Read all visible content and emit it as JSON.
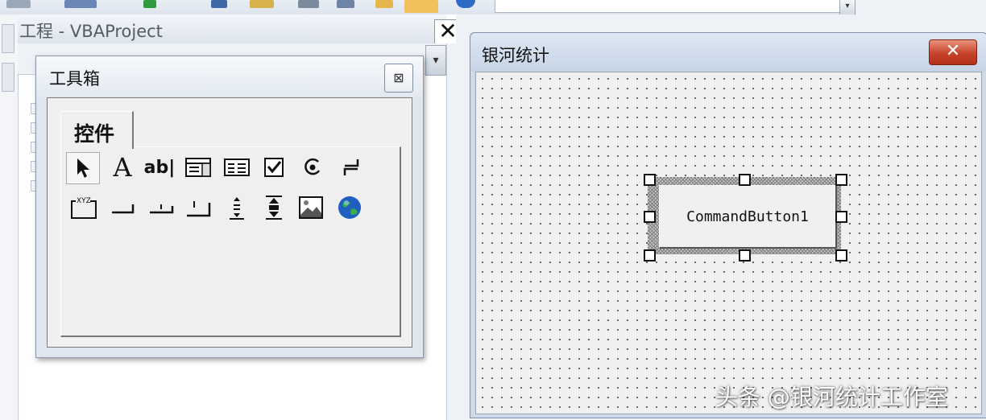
{
  "project_explorer": {
    "title": "工程 - VBAProject",
    "close_label": "✕"
  },
  "toolbox": {
    "title": "工具箱",
    "close_label": "⊠",
    "tab_label": "控件",
    "tools_row1": [
      {
        "icon": "select-objects-icon",
        "glyph": "➤"
      },
      {
        "icon": "label-icon",
        "glyph": "A"
      },
      {
        "icon": "textbox-icon",
        "glyph": "ab|"
      },
      {
        "icon": "combobox-icon",
        "glyph": "▤"
      },
      {
        "icon": "listbox-icon",
        "glyph": "▥"
      },
      {
        "icon": "checkbox-icon",
        "glyph": "☑"
      },
      {
        "icon": "optionbutton-icon",
        "glyph": "◉"
      },
      {
        "icon": "togglebutton-icon",
        "glyph": "⊐"
      }
    ],
    "tools_row2": [
      {
        "icon": "frame-icon",
        "glyph": "XYZ"
      },
      {
        "icon": "commandbutton-icon",
        "glyph": "▭"
      },
      {
        "icon": "tabstrip-icon",
        "glyph": "⊔"
      },
      {
        "icon": "multipage-icon",
        "glyph": "⊔"
      },
      {
        "icon": "scrollbar-icon",
        "glyph": "⇕"
      },
      {
        "icon": "spinbutton-icon",
        "glyph": "⬍"
      },
      {
        "icon": "image-icon",
        "glyph": "🖼"
      },
      {
        "icon": "refedit-icon",
        "glyph": "🌐"
      }
    ]
  },
  "userform": {
    "title": "银河统计",
    "close_label": "✕",
    "command_button_caption": "CommandButton1"
  },
  "watermark": "头条 @银河统计工作室"
}
